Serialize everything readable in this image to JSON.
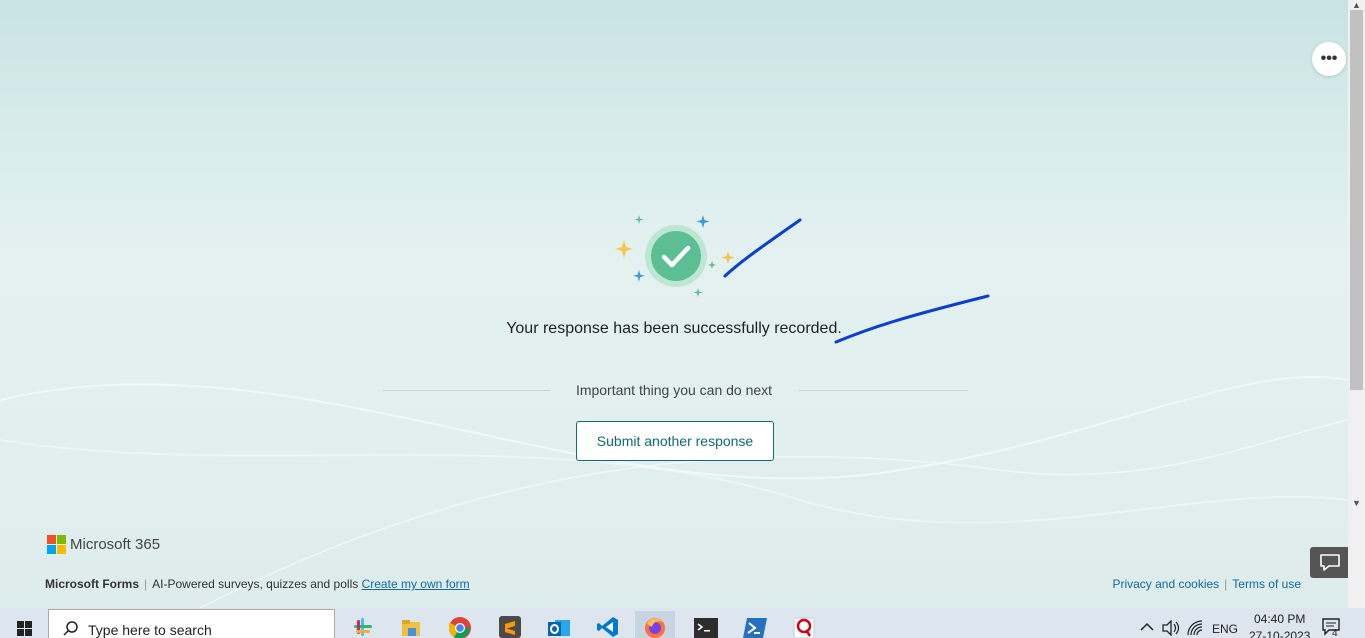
{
  "page": {
    "more_button_label": "•••",
    "success_message": "Your response has been successfully recorded.",
    "next_heading": "Important thing you can do next",
    "submit_another_label": "Submit another response"
  },
  "footer": {
    "brand": "Microsoft 365",
    "product": "Microsoft Forms",
    "tagline": "AI-Powered surveys, quizzes and polls",
    "create_link": "Create my own form",
    "privacy_link": "Privacy and cookies",
    "terms_link": "Terms of use",
    "separator": "|"
  },
  "taskbar": {
    "search_placeholder": "Type here to search",
    "apps": [
      "slack-icon",
      "file-explorer-icon",
      "chrome-icon",
      "sublime-text-icon",
      "outlook-icon",
      "vscode-icon",
      "firefox-icon",
      "terminal-icon",
      "powershell-icon",
      "q-app-icon"
    ],
    "active_app": "firefox-icon",
    "language": "ENG",
    "time": "04:40 PM",
    "date": "27-10-2023",
    "notification_count": "4"
  },
  "colors": {
    "accent": "#0f6b6e",
    "link": "#0f6b9e",
    "annotation_ink": "#0a3fd1",
    "check_green": "#5cbf93"
  }
}
